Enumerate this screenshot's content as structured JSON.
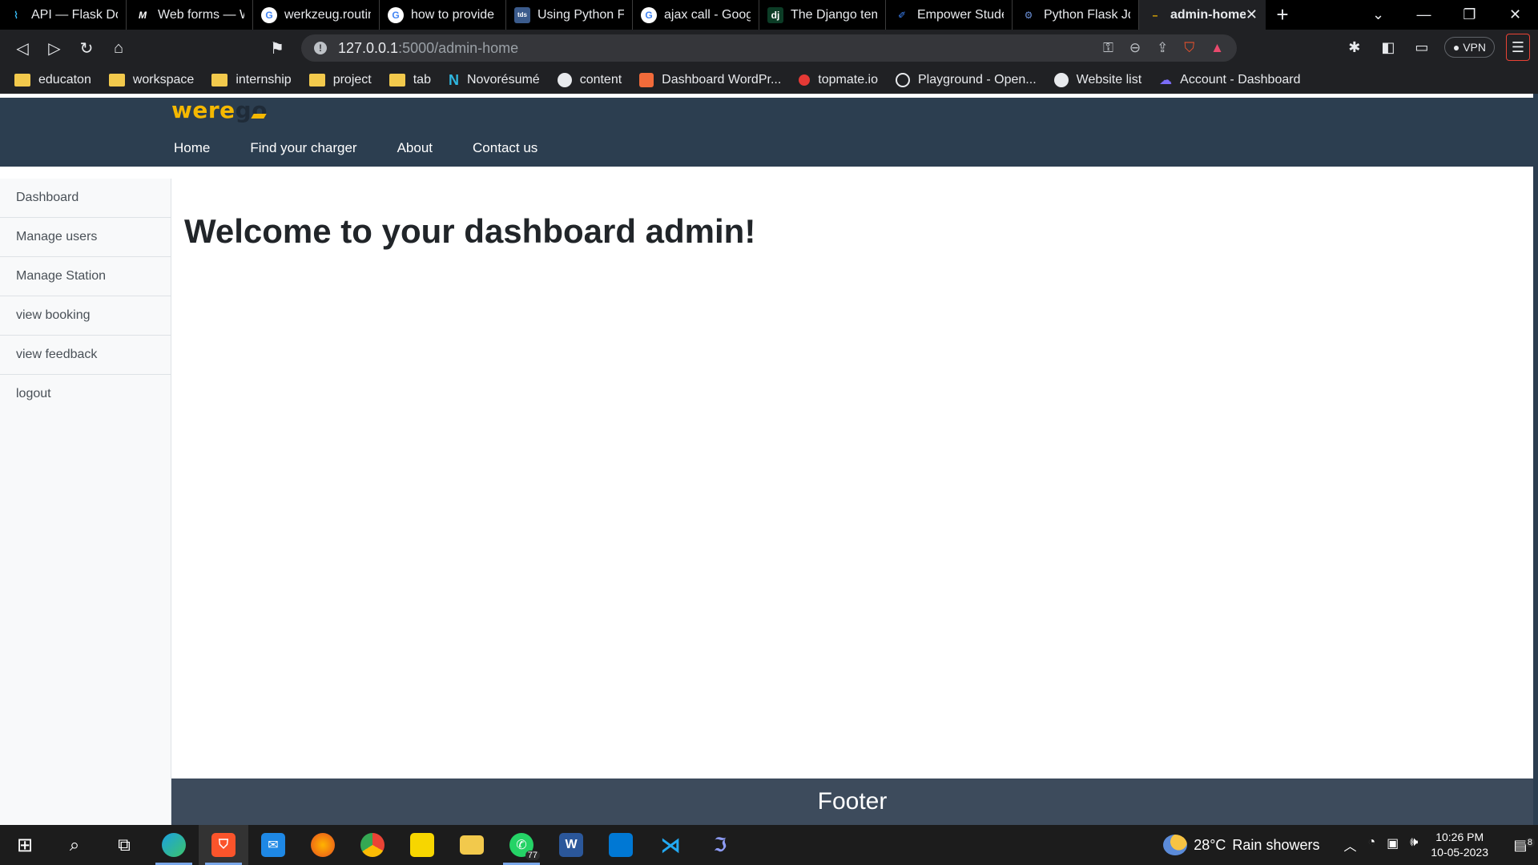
{
  "browser": {
    "tabs": [
      {
        "label": "API — Flask Docu",
        "icon": "flask-icon",
        "icon_color": "#38bdf8",
        "icon_text": "⌇"
      },
      {
        "label": "Web forms — W",
        "icon": "mdn-icon",
        "icon_color": "#ffffff",
        "icon_text": "M"
      },
      {
        "label": "werkzeug.routing",
        "icon": "google-icon",
        "icon_color": "#ffffff",
        "icon_text": "G"
      },
      {
        "label": "how to provide li",
        "icon": "google-icon",
        "icon_color": "#ffffff",
        "icon_text": "G"
      },
      {
        "label": "Using Python Fla",
        "icon": "tds-icon",
        "icon_color": "#3b5b8c",
        "icon_text": "tds"
      },
      {
        "label": "ajax call - Google",
        "icon": "google-icon",
        "icon_color": "#ffffff",
        "icon_text": "G"
      },
      {
        "label": "The Django temp",
        "icon": "django-icon",
        "icon_color": "#0c3c26",
        "icon_text": "dj"
      },
      {
        "label": "Empower Studen",
        "icon": "empower-icon",
        "icon_color": "#3b82f6",
        "icon_text": "✐"
      },
      {
        "label": "Python Flask Jqu",
        "icon": "python-flask-icon",
        "icon_color": "#6b8fd6",
        "icon_text": "⚙"
      }
    ],
    "active_tab": {
      "label": "admin-home",
      "icon": "loading-icon"
    },
    "address": {
      "host": "127.0.0.1",
      "path": ":5000/admin-home"
    },
    "vpn_label": "VPN",
    "bookmarks": [
      {
        "label": "educaton",
        "type": "folder"
      },
      {
        "label": "workspace",
        "type": "folder"
      },
      {
        "label": "internship",
        "type": "folder"
      },
      {
        "label": "project",
        "type": "folder"
      },
      {
        "label": "tab",
        "type": "folder"
      },
      {
        "label": "Novorésumé",
        "type": "novoresume"
      },
      {
        "label": "content",
        "type": "globe"
      },
      {
        "label": "Dashboard WordPr...",
        "type": "wordpress"
      },
      {
        "label": "topmate.io",
        "type": "topmate"
      },
      {
        "label": "Playground - Open...",
        "type": "openai"
      },
      {
        "label": "Website list",
        "type": "globe"
      },
      {
        "label": "Account - Dashboard",
        "type": "account"
      }
    ]
  },
  "site": {
    "logo_main": "were",
    "logo_accent": "go",
    "nav": [
      "Home",
      "Find your charger",
      "About",
      "Contact us"
    ],
    "sidebar": [
      "Dashboard",
      "Manage users",
      "Manage Station",
      "view booking",
      "view feedback",
      "logout"
    ],
    "title": "Welcome to your dashboard admin!",
    "footer": "Footer"
  },
  "taskbar": {
    "whatsapp_badge": "77",
    "weather_temp": "28°C",
    "weather_desc": "Rain showers",
    "time": "10:26 PM",
    "date": "10-05-2023",
    "notification_count": "8"
  },
  "colors": {
    "header_bg": "#2c3e50",
    "footer_bg": "#3d4b5c",
    "logo_yellow": "#f5b800"
  }
}
